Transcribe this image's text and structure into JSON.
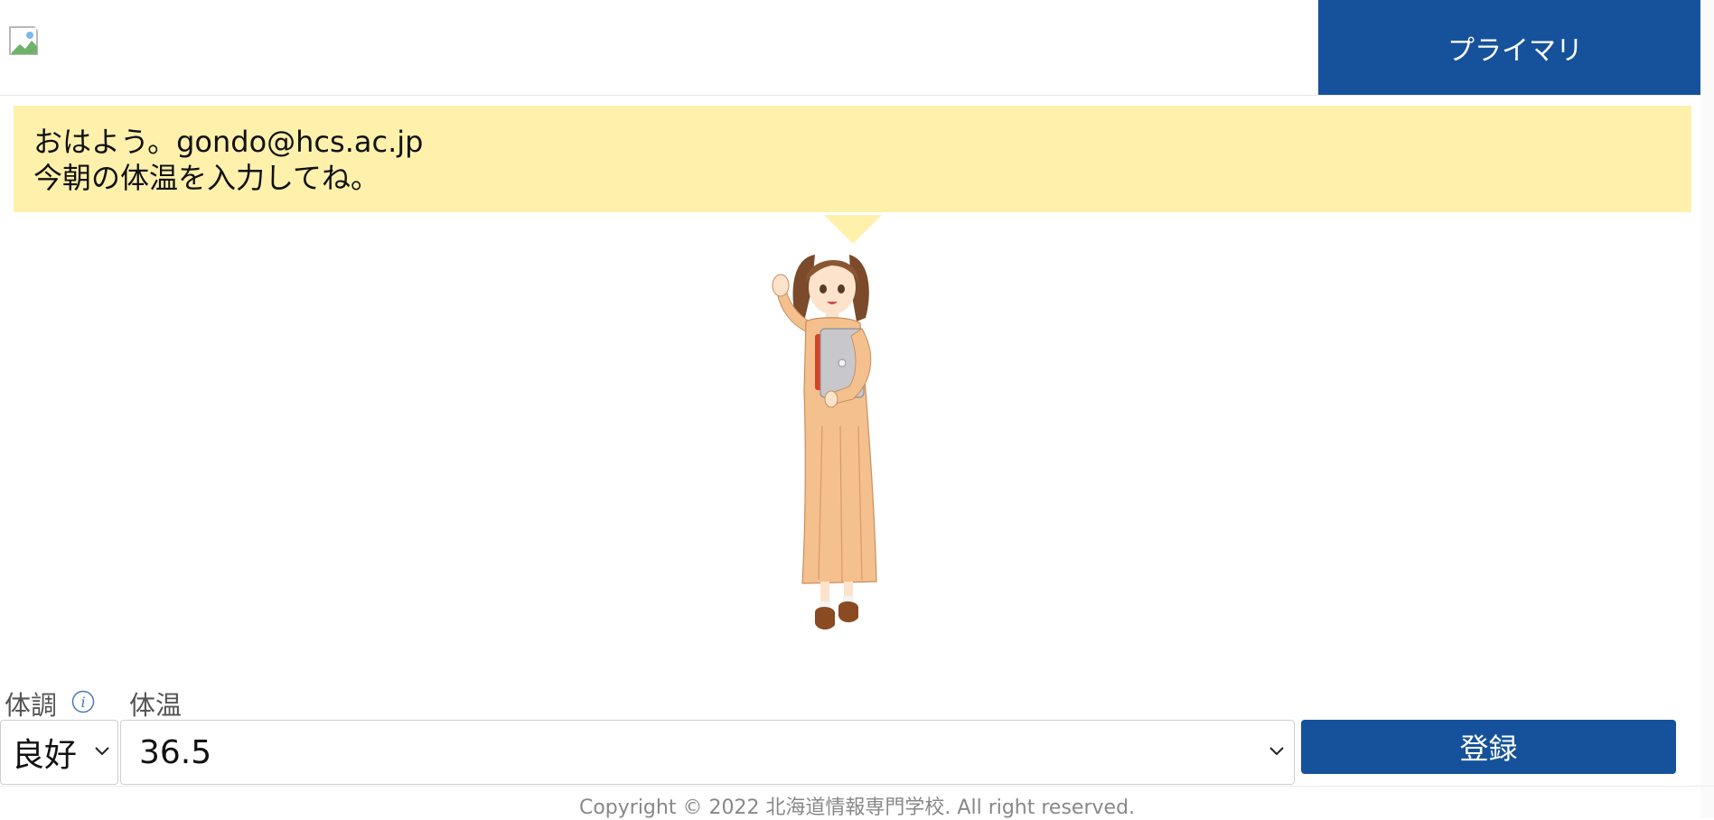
{
  "header": {
    "logo_alt": "",
    "primary_button_label": "プライマリ"
  },
  "greeting": {
    "line1": "おはよう。gondo@hcs.ac.jp",
    "line2": "今朝の体温を入力してね。"
  },
  "form": {
    "condition_label": "体調",
    "temperature_label": "体温",
    "condition_value": "良好",
    "temperature_value": "36.5",
    "register_label": "登録"
  },
  "footer": {
    "copyright": "Copyright © 2022 北海道情報専門学校. All right reserved."
  },
  "colors": {
    "primary": "#16529c",
    "bubble": "#fff1ac"
  },
  "icons": {
    "logo": "broken-image-icon",
    "info": "info-icon",
    "dropdown": "chevron-down-icon"
  }
}
